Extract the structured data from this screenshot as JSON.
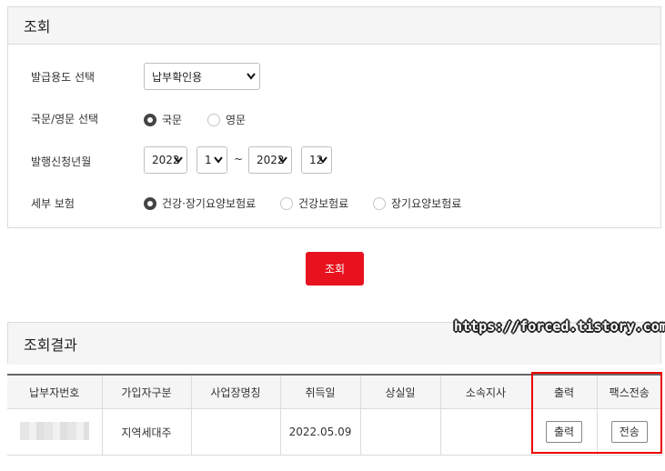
{
  "query": {
    "title": "조회",
    "purpose": {
      "label": "발급용도 선택",
      "value": "납부확인용"
    },
    "language": {
      "label": "국문/영문 선택",
      "options": [
        "국문",
        "영문"
      ],
      "selected": "국문"
    },
    "period": {
      "label": "발행신청년월",
      "from_year": "2022",
      "from_month": "1",
      "separator": "~",
      "to_year": "2022",
      "to_month": "12"
    },
    "insurance": {
      "label": "세부 보험",
      "options": [
        "건강·장기요양보험료",
        "건강보험료",
        "장기요양보험료"
      ],
      "selected": "건강·장기요양보험료"
    },
    "search_button": "조회"
  },
  "watermark": "https://forced.tistory.com",
  "results": {
    "title": "조회결과",
    "columns": [
      "납부자번호",
      "가입자구분",
      "사업장명칭",
      "취득일",
      "상실일",
      "소속지사",
      "출력",
      "팩스전송"
    ],
    "rows": [
      {
        "payer_no": "",
        "subscriber_type": "지역세대주",
        "workplace": "",
        "acquired": "2022.05.09",
        "lost": "",
        "branch": "",
        "print_button": "출력",
        "fax_button": "전송"
      }
    ]
  },
  "colors": {
    "accent": "#e8121f",
    "highlight_box": "#e00000"
  }
}
